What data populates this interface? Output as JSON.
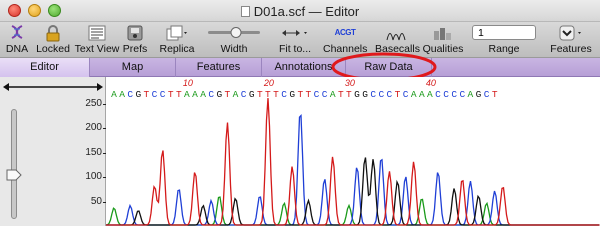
{
  "window": {
    "title": "D01a.scf — Editor"
  },
  "toolbar": {
    "dna": "DNA",
    "locked": "Locked",
    "text_view": "Text View",
    "prefs": "Prefs",
    "replica": "Replica",
    "width": "Width",
    "fit_to": "Fit to...",
    "channels": "Channels",
    "channels_icon_text": "ACGT",
    "basecalls": "Basecalls",
    "qualities": "Qualities",
    "range": "Range",
    "range_value": "1",
    "features": "Features"
  },
  "tabs": [
    "Editor",
    "Map",
    "Features",
    "Annotations",
    "Raw Data"
  ],
  "active_tab": "Editor",
  "highlighted_tab": "Raw Data",
  "sequence": "AACGTCCTTAAACGTACGTTTCGTTCCATTGGCCCTCAAACCCCAGCT",
  "position_labels": [
    {
      "pos": 10,
      "label": "10"
    },
    {
      "pos": 20,
      "label": "20"
    },
    {
      "pos": 30,
      "label": "30"
    },
    {
      "pos": 40,
      "label": "40"
    }
  ],
  "colors": {
    "A": "#1a9a1a",
    "C": "#1f3fd6",
    "G": "#111111",
    "T": "#d41a1a",
    "highlight": "#e0191c"
  },
  "chart_data": {
    "type": "line",
    "yticks": [
      50,
      100,
      150,
      200,
      250
    ],
    "ylim": [
      0,
      260
    ],
    "xlabel": "",
    "ylabel": "",
    "series": [
      {
        "channel": "A",
        "peaks": [
          [
            0,
            35
          ],
          [
            13,
            60
          ],
          [
            21,
            45
          ],
          [
            29,
            40
          ],
          [
            38,
            55
          ],
          [
            46,
            45
          ]
        ]
      },
      {
        "channel": "C",
        "peaks": [
          [
            2,
            40
          ],
          [
            8,
            75
          ],
          [
            12,
            50
          ],
          [
            18,
            60
          ],
          [
            23,
            235
          ],
          [
            26,
            95
          ],
          [
            30,
            120
          ],
          [
            33,
            140
          ],
          [
            36,
            100
          ],
          [
            40,
            110
          ],
          [
            44,
            90
          ],
          [
            47,
            70
          ]
        ]
      },
      {
        "channel": "G",
        "peaks": [
          [
            3,
            30
          ],
          [
            11,
            40
          ],
          [
            15,
            55
          ],
          [
            24,
            50
          ],
          [
            31,
            140
          ],
          [
            32,
            135
          ],
          [
            35,
            90
          ],
          [
            42,
            75
          ],
          [
            45,
            60
          ]
        ]
      },
      {
        "channel": "T",
        "peaks": [
          [
            5,
            80
          ],
          [
            6,
            155
          ],
          [
            10,
            110
          ],
          [
            14,
            210
          ],
          [
            19,
            260
          ],
          [
            22,
            120
          ],
          [
            27,
            140
          ],
          [
            34,
            110
          ],
          [
            37,
            130
          ],
          [
            43,
            95
          ],
          [
            48,
            80
          ]
        ]
      }
    ]
  }
}
